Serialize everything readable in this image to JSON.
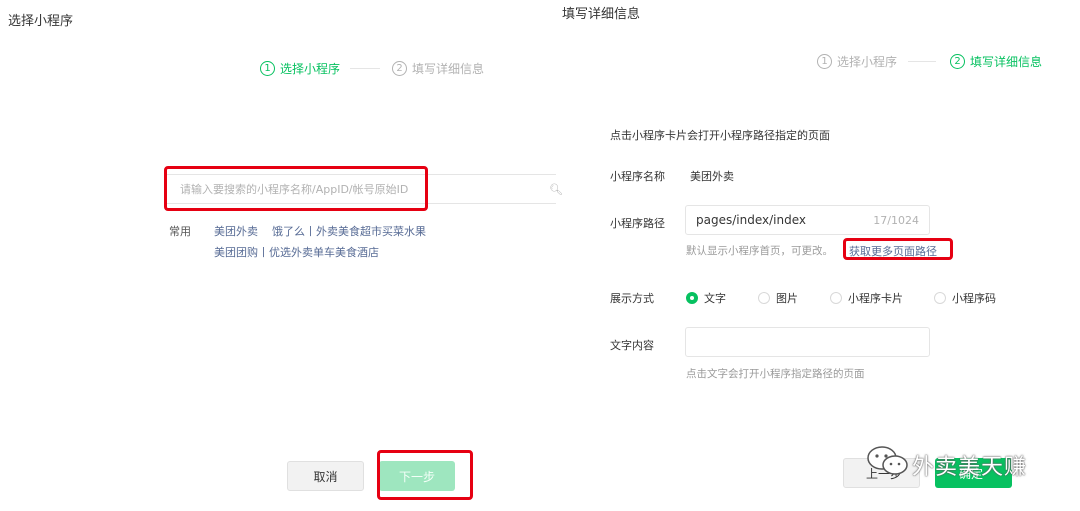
{
  "left": {
    "title": "选择小程序",
    "steps": [
      {
        "num": "1",
        "label": "选择小程序"
      },
      {
        "num": "2",
        "label": "填写详细信息"
      }
    ],
    "search": {
      "placeholder": "请输入要搜索的小程序名称/AppID/帐号原始ID",
      "value": ""
    },
    "common": {
      "label": "常用",
      "row1": [
        "美团外卖",
        "饿了么丨外卖美食超市买菜水果"
      ],
      "row2": [
        "美团团购丨优选外卖单车美食酒店"
      ]
    },
    "buttons": {
      "cancel": "取消",
      "next": "下一步"
    }
  },
  "right": {
    "title": "填写详细信息",
    "steps": [
      {
        "num": "1",
        "label": "选择小程序"
      },
      {
        "num": "2",
        "label": "填写详细信息"
      }
    ],
    "intro": "点击小程序卡片会打开小程序路径指定的页面",
    "name": {
      "label": "小程序名称",
      "value": "美团外卖"
    },
    "path": {
      "label": "小程序路径",
      "value": "pages/index/index",
      "counter": "17/1024",
      "hint": "默认显示小程序首页，可更改。",
      "link": "获取更多页面路径"
    },
    "display": {
      "label": "展示方式",
      "options": [
        "文字",
        "图片",
        "小程序卡片",
        "小程序码"
      ],
      "selected": "文字"
    },
    "text_content": {
      "label": "文字内容",
      "value": "",
      "hint": "点击文字会打开小程序指定路径的页面"
    },
    "buttons": {
      "prev": "上一步",
      "confirm": "确定"
    }
  },
  "watermark": "外卖美天赚",
  "colors": {
    "accent": "#07c160",
    "link": "#576b95",
    "highlight": "#e60012"
  }
}
